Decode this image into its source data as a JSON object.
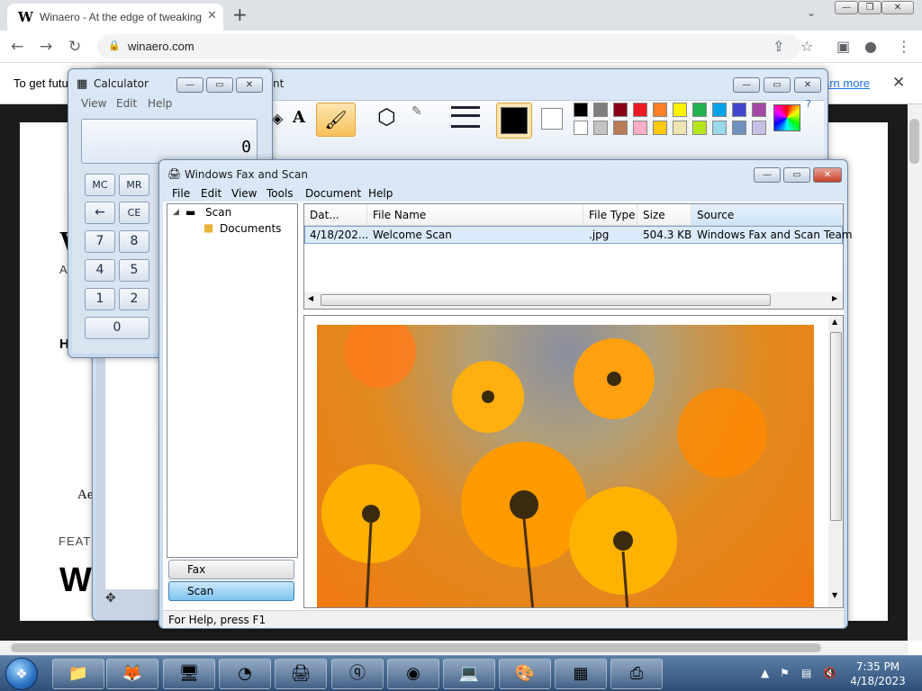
{
  "browser": {
    "tab_title": "Winaero - At the edge of tweaking",
    "tab_favicon": "W",
    "url": "winaero.com",
    "infobar_text": "To get futu",
    "infobar_link": "arn more",
    "icons": [
      "back-icon",
      "forward-icon",
      "reload-icon",
      "lock-icon",
      "share-icon",
      "star-icon",
      "sidebar-icon",
      "profile-icon",
      "menu-icon"
    ]
  },
  "page": {
    "w1": "W",
    "a1": "A",
    "h1": "H",
    "ae": "Ae",
    "feat": "FEAT",
    "w2": "W"
  },
  "paint": {
    "title_fragment": "nt",
    "colors": [
      "#000000",
      "#7f7f7f",
      "#880015",
      "#ed1c24",
      "#ff7f27",
      "#fff200",
      "#22b14c",
      "#00a2e8",
      "#3f48cc",
      "#a349a4",
      "#ffffff",
      "#c3c3c3",
      "#b97a57",
      "#ffaec9",
      "#ffc90e",
      "#efe4b0",
      "#b5e61d",
      "#99d9ea",
      "#7092be",
      "#c8bfe7"
    ]
  },
  "calculator": {
    "title": "Calculator",
    "menu": [
      "View",
      "Edit",
      "Help"
    ],
    "display": "0",
    "buttons": [
      "MC",
      "MR",
      "←",
      "CE",
      "7",
      "8",
      "4",
      "5",
      "1",
      "2",
      "0"
    ]
  },
  "fax": {
    "title": "Windows Fax and Scan",
    "menu": [
      "File",
      "Edit",
      "View",
      "Tools",
      "Document",
      "Help"
    ],
    "tree": {
      "root": "Scan",
      "child": "Documents"
    },
    "nav": {
      "fax": "Fax",
      "scan": "Scan"
    },
    "columns": [
      "Dat...",
      "File Name",
      "File Type",
      "Size",
      "Source"
    ],
    "row": {
      "date": "4/18/202...",
      "name": "Welcome Scan",
      "type": ".jpg",
      "size": "504.3 KB",
      "source": "Windows Fax and Scan Team"
    },
    "status": "For Help, press F1"
  },
  "taskbar": {
    "time": "7:35 PM",
    "date": "4/18/2023"
  }
}
